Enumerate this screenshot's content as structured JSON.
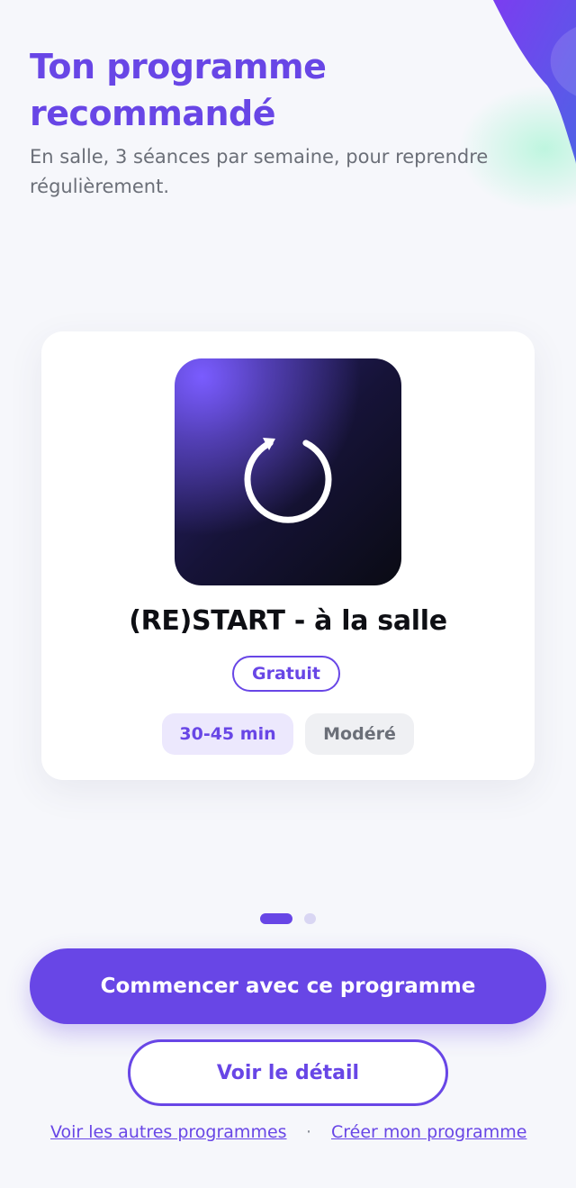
{
  "header": {
    "title": "Ton programme recommandé",
    "subtitle": "En salle, 3 séances par semaine, pour reprendre régulièrement."
  },
  "program_card": {
    "icon": "restart-icon",
    "name": "(RE)START - à la salle",
    "price_badge": "Gratuit",
    "duration": "30-45 min",
    "intensity": "Modéré"
  },
  "carousel": {
    "pages": 2,
    "active_index": 0
  },
  "actions": {
    "primary_label": "Commencer avec ce programme",
    "secondary_label": "Voir le détail",
    "link_other_programs": "Voir les autres programmes",
    "separator": "·",
    "link_create_program": "Créer mon programme"
  },
  "colors": {
    "accent": "#6846e6",
    "background": "#f6f7fb",
    "text_dark": "#0e0f14",
    "text_muted": "#6b6f78"
  }
}
